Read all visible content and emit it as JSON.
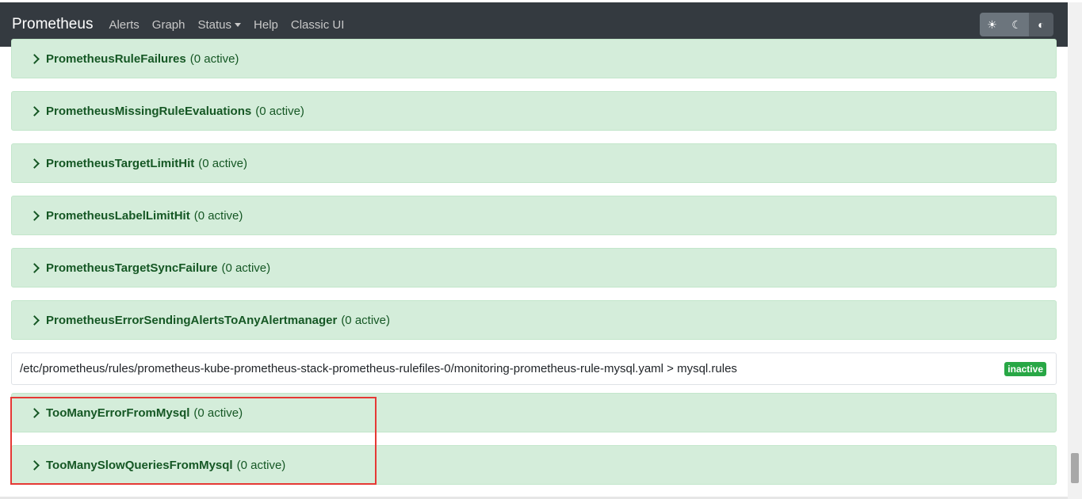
{
  "navbar": {
    "brand": "Prometheus",
    "links": [
      "Alerts",
      "Graph",
      "Status",
      "Help",
      "Classic UI"
    ],
    "theme_icons": [
      "sun-icon",
      "moon-icon",
      "contrast-icon"
    ]
  },
  "rules_top": [
    {
      "name": "PrometheusRuleFailures",
      "count": "(0 active)"
    },
    {
      "name": "PrometheusMissingRuleEvaluations",
      "count": "(0 active)"
    },
    {
      "name": "PrometheusTargetLimitHit",
      "count": "(0 active)"
    },
    {
      "name": "PrometheusLabelLimitHit",
      "count": "(0 active)"
    },
    {
      "name": "PrometheusTargetSyncFailure",
      "count": "(0 active)"
    },
    {
      "name": "PrometheusErrorSendingAlertsToAnyAlertmanager",
      "count": "(0 active)"
    }
  ],
  "group": {
    "path": "/etc/prometheus/rules/prometheus-kube-prometheus-stack-prometheus-rulefiles-0/monitoring-prometheus-rule-mysql.yaml > mysql.rules",
    "status": "inactive"
  },
  "rules_mysql": [
    {
      "name": "TooManyErrorFromMysql",
      "count": "(0 active)"
    },
    {
      "name": "TooManySlowQueriesFromMysql",
      "count": "(0 active)"
    }
  ],
  "colors": {
    "navbar_bg": "#343a40",
    "rule_bg": "#d4edda",
    "rule_text": "#155724",
    "badge_bg": "#28a745",
    "highlight_border": "#e53935"
  }
}
